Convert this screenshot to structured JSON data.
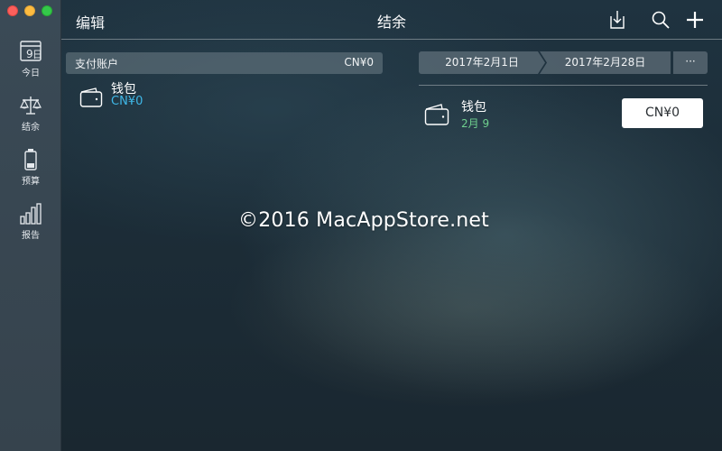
{
  "sidebar": {
    "items": [
      {
        "label": "今日",
        "icon": "calendar-icon",
        "day": "9"
      },
      {
        "label": "结余",
        "icon": "scale-icon"
      },
      {
        "label": "预算",
        "icon": "battery-icon"
      },
      {
        "label": "报告",
        "icon": "bar-chart-icon"
      }
    ]
  },
  "header": {
    "edit_label": "编辑",
    "title": "结余",
    "tools": [
      "import-icon",
      "search-icon",
      "plus-icon"
    ]
  },
  "accounts": {
    "group_label": "支付账户",
    "group_total": "CN¥0",
    "items": [
      {
        "name": "钱包",
        "balance": "CN¥0",
        "icon": "wallet-icon"
      }
    ]
  },
  "range": {
    "start": "2017年2月1日",
    "end": "2017年2月28日",
    "more": "···"
  },
  "balance_row": {
    "name": "钱包",
    "date": "2月 9",
    "value": "CN¥0",
    "icon": "wallet-icon"
  },
  "watermark": "©2016 MacAppStore.net",
  "colors": {
    "sidebar_bg": "#3a4a56",
    "accent_blue": "#3fb8e8",
    "accent_green": "#6fd08e"
  }
}
